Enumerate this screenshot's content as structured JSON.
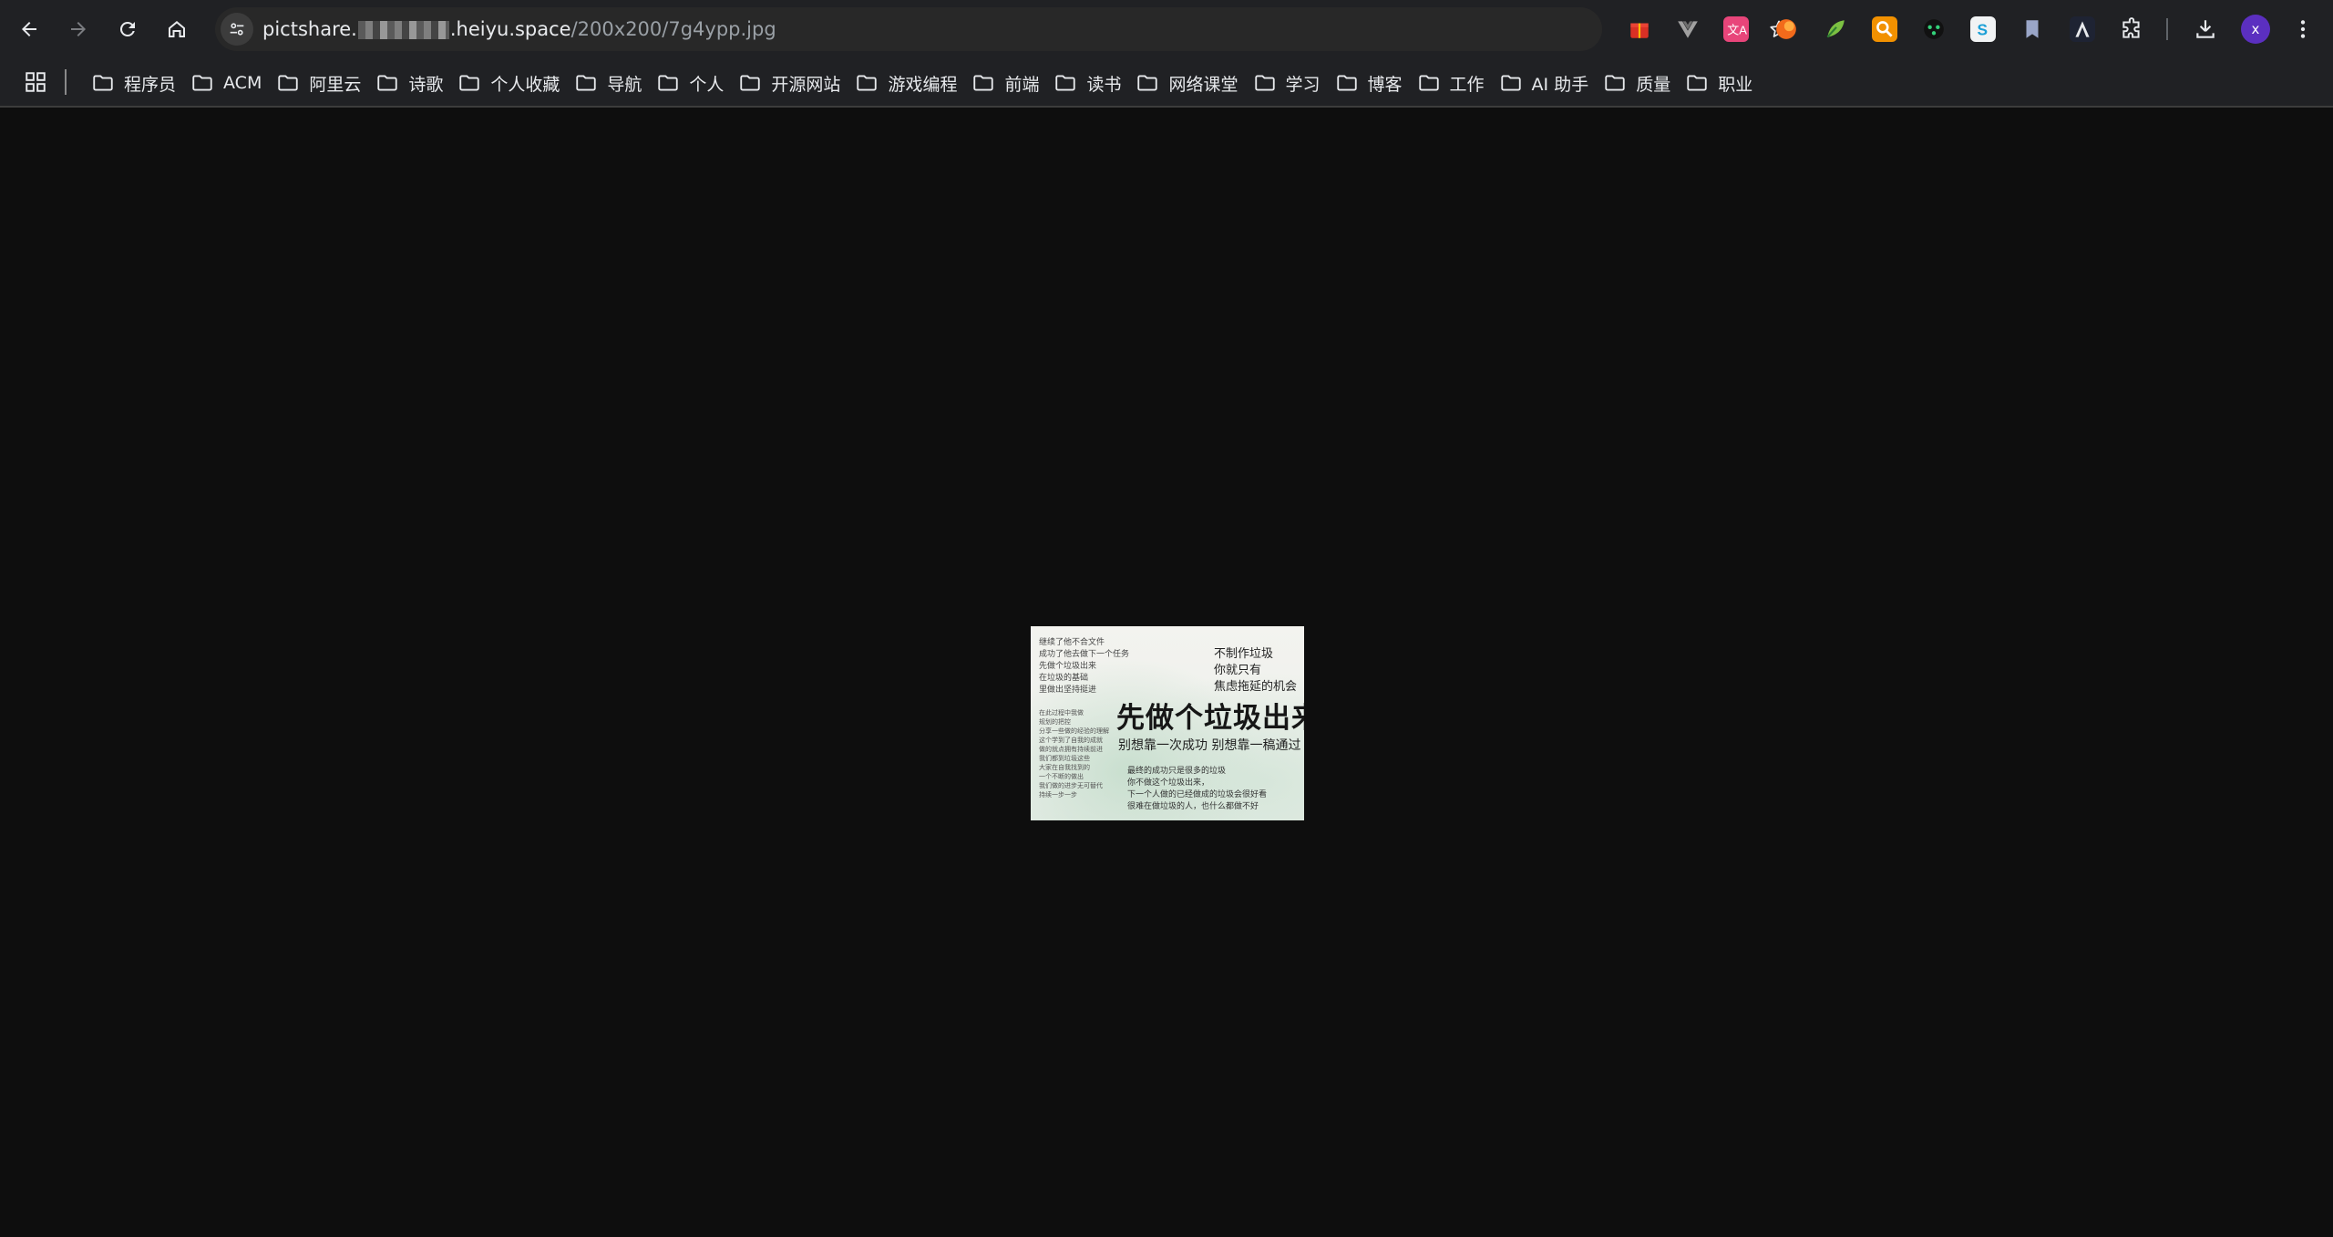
{
  "toolbar": {
    "url": {
      "prefix": "pictshare.",
      "domain_rest": ".heiyu.space",
      "path": "/200x200/7g4ypp.jpg"
    },
    "avatar_initial": "x"
  },
  "bookmarks": [
    {
      "label": "程序员"
    },
    {
      "label": "ACM"
    },
    {
      "label": "阿里云"
    },
    {
      "label": "诗歌"
    },
    {
      "label": "个人收藏"
    },
    {
      "label": "导航"
    },
    {
      "label": "个人"
    },
    {
      "label": "开源网站"
    },
    {
      "label": "游戏编程"
    },
    {
      "label": "前端"
    },
    {
      "label": "读书"
    },
    {
      "label": "网络课堂"
    },
    {
      "label": "学习"
    },
    {
      "label": "博客"
    },
    {
      "label": "工作"
    },
    {
      "label": "AI 助手"
    },
    {
      "label": "质量"
    },
    {
      "label": "职业"
    }
  ],
  "image": {
    "small_lines": [
      "继续了他不合文件",
      "成功了他去做下一个任务",
      "先做个垃圾出来",
      "在垃圾的基础",
      "里做出坚持挺进"
    ],
    "tiny_lines": [
      "在此过程中我做",
      "规划的把控",
      "分享一些做的经验的理解",
      "这个学到了自我的成就",
      "做的就点拥有持续前进",
      "我们都到垃圾这些",
      "大家在自我找到的",
      "一个不断的做出",
      "我们做的进步无可替代",
      "持续一步一步"
    ],
    "right_note": [
      "不制作垃圾",
      "你就只有",
      "焦虑拖延的机会"
    ],
    "headline": "先做个垃圾出来",
    "subline": "别想靠一次成功  别想靠一稿通过",
    "bottom_lines": [
      "最终的成功只是很多的垃圾",
      "你不做这个垃圾出来，",
      "下一个人做的已经做成的垃圾会很好看",
      "很难在做垃圾的人，也什么都做不好"
    ]
  },
  "colors": {
    "toolbar_bg": "#202124",
    "page_bg": "#0e0e0e",
    "avatar_bg": "#5b2fc0"
  }
}
